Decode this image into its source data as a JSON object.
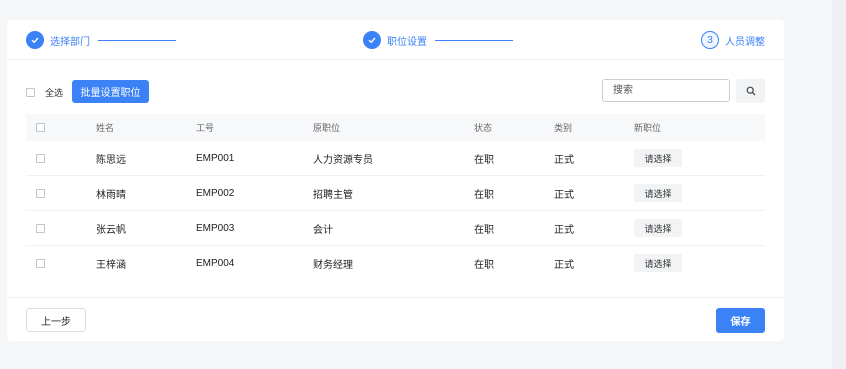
{
  "steps": [
    {
      "index": "1",
      "label": "选择部门",
      "status": "done"
    },
    {
      "index": "2",
      "label": "职位设置",
      "status": "done"
    },
    {
      "index": "3",
      "label": "人员调整",
      "status": "active"
    }
  ],
  "toolbar": {
    "select_all_label": "全选",
    "batch_button": "批量设置职位",
    "search_placeholder": "搜索",
    "search_value": ""
  },
  "table": {
    "headers": [
      "姓名",
      "工号",
      "原职位",
      "状态",
      "类别",
      "新职位"
    ],
    "rows": [
      {
        "name": "陈思远",
        "id": "EMP001",
        "position": "人力资源专员",
        "status": "在职",
        "type": "正式",
        "action": "请选择"
      },
      {
        "name": "林雨晴",
        "id": "EMP002",
        "position": "招聘主管",
        "status": "在职",
        "type": "正式",
        "action": "请选择"
      },
      {
        "name": "张云帆",
        "id": "EMP003",
        "position": "会计",
        "status": "在职",
        "type": "正式",
        "action": "请选择"
      },
      {
        "name": "王梓涵",
        "id": "EMP004",
        "position": "财务经理",
        "status": "在职",
        "type": "正式",
        "action": "请选择"
      }
    ]
  },
  "footer": {
    "prev_button": "上一步",
    "save_button": "保存"
  },
  "colors": {
    "accent": "#3b82f6",
    "background": "#f5f6f8"
  },
  "icons": {
    "check": "check-icon",
    "search": "search-icon"
  }
}
